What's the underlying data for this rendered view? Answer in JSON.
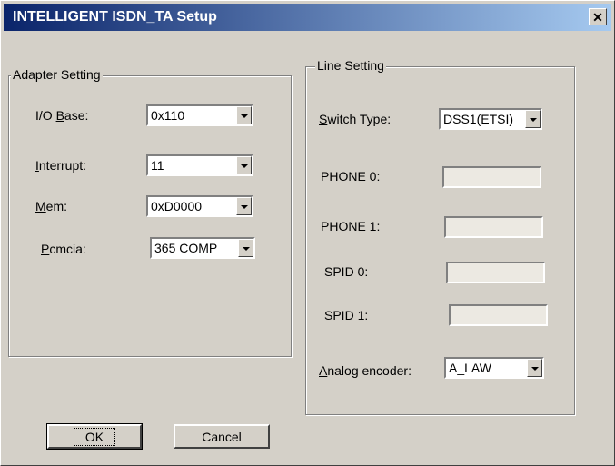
{
  "window": {
    "title": "INTELLIGENT ISDN_TA Setup",
    "close_glyph": "✕"
  },
  "adapter": {
    "group_title": "Adapter Setting",
    "io_base": {
      "label_mnemonic": "I/O ",
      "label_u": "B",
      "label_rest": "ase:",
      "value": "0x110"
    },
    "interrupt": {
      "label_u": "I",
      "label_rest": "nterrupt:",
      "value": "11"
    },
    "mem": {
      "label_u": "M",
      "label_rest": "em:",
      "value": "0xD0000"
    },
    "pcmcia": {
      "label_u": "P",
      "label_rest": "cmcia:",
      "value": "365 COMP"
    }
  },
  "line": {
    "group_title": "Line Setting",
    "switch_type": {
      "label_u": "S",
      "label_rest": "witch Type:",
      "value": "DSS1(ETSI)"
    },
    "phone0": {
      "label": "PHONE 0:",
      "value": ""
    },
    "phone1": {
      "label": "PHONE 1:",
      "value": ""
    },
    "spid0": {
      "label": "SPID 0:",
      "value": ""
    },
    "spid1": {
      "label": "SPID 1:",
      "value": ""
    },
    "analog": {
      "label_u": "A",
      "label_rest": "nalog encoder:",
      "value": "A_LAW"
    }
  },
  "buttons": {
    "ok": "OK",
    "cancel": "Cancel"
  }
}
